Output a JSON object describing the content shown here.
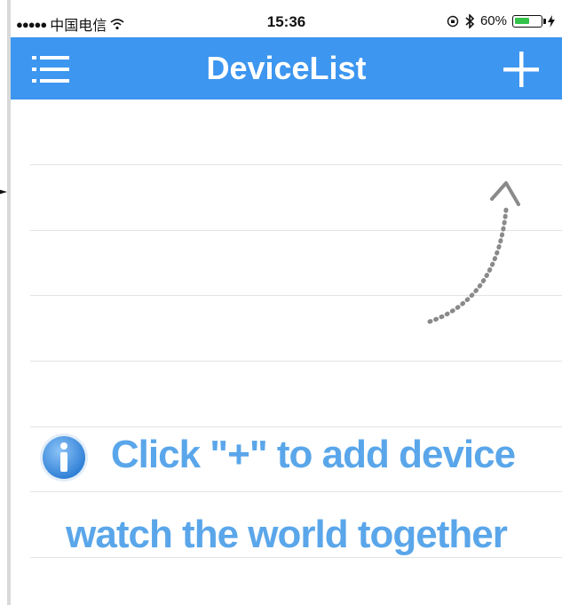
{
  "status_bar": {
    "carrier": "中国电信",
    "signal": "●●●●●",
    "time": "15:36",
    "battery_percent": "60%",
    "battery_level": 0.6
  },
  "nav": {
    "title": "DeviceList",
    "menu_icon": "menu-icon",
    "add_icon": "plus-icon"
  },
  "empty_state": {
    "line1": "Click \"+\" to add device",
    "line2": "watch the world together",
    "icon": "info-icon"
  },
  "colors": {
    "nav_background": "#3d96f0",
    "hint_text": "#5aa6ea",
    "battery_fill": "#34c34a"
  }
}
